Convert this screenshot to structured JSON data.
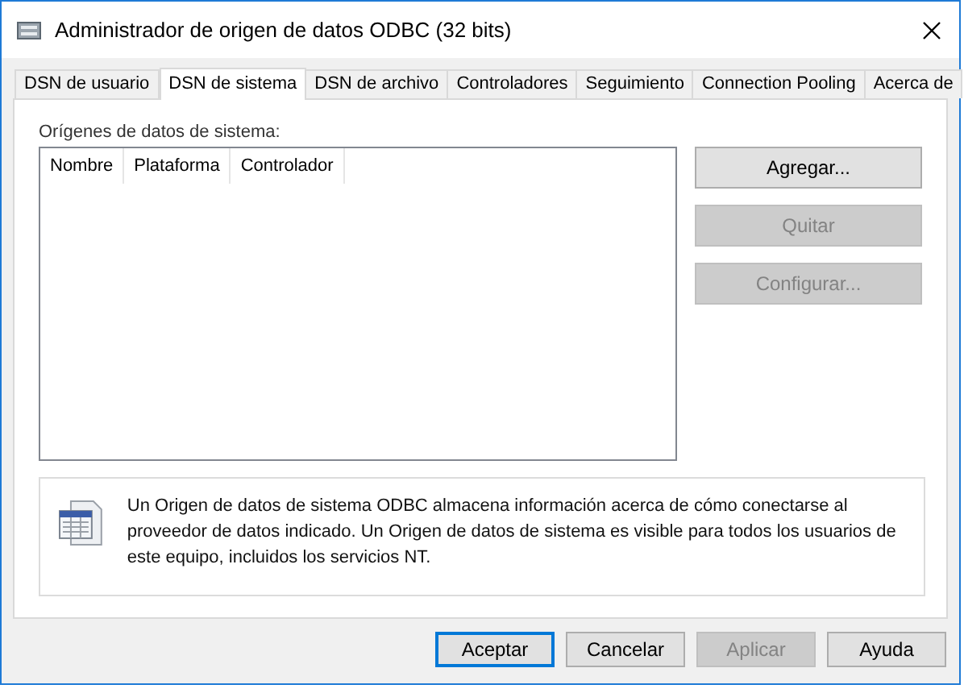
{
  "window": {
    "title": "Administrador de origen de datos ODBC (32 bits)"
  },
  "tabs": [
    {
      "label": "DSN de usuario",
      "selected": false
    },
    {
      "label": "DSN de sistema",
      "selected": true
    },
    {
      "label": "DSN de archivo",
      "selected": false
    },
    {
      "label": "Controladores",
      "selected": false
    },
    {
      "label": "Seguimiento",
      "selected": false
    },
    {
      "label": "Connection Pooling",
      "selected": false
    },
    {
      "label": "Acerca de",
      "selected": false
    }
  ],
  "list_label": "Orígenes de datos de sistema:",
  "list_columns": [
    "Nombre",
    "Plataforma",
    "Controlador"
  ],
  "side_buttons": [
    {
      "label": "Agregar...",
      "disabled": false
    },
    {
      "label": "Quitar",
      "disabled": true
    },
    {
      "label": "Configurar...",
      "disabled": true
    }
  ],
  "info": "Un Origen de datos de sistema ODBC almacena información acerca de cómo conectarse al proveedor de datos indicado. Un Origen de datos de sistema es visible para todos los usuarios de este equipo, incluidos los servicios NT.",
  "dialog_buttons": [
    {
      "label": "Aceptar",
      "disabled": false,
      "default": true
    },
    {
      "label": "Cancelar",
      "disabled": false,
      "default": false
    },
    {
      "label": "Aplicar",
      "disabled": true,
      "default": false
    },
    {
      "label": "Ayuda",
      "disabled": false,
      "default": false
    }
  ]
}
